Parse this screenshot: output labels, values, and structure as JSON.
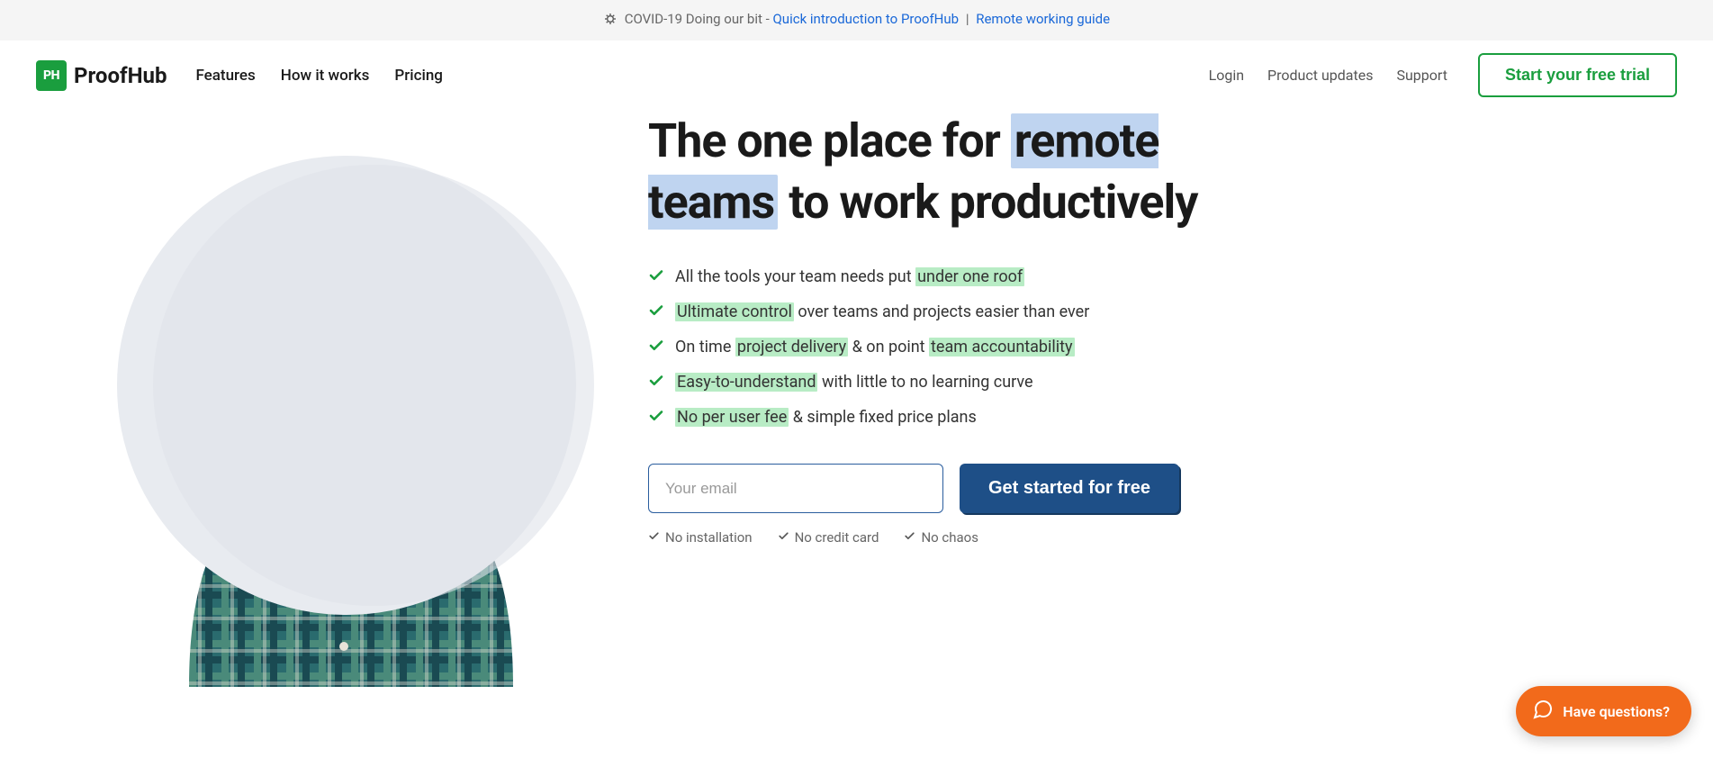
{
  "announcement": {
    "covid_text": "COVID-19 Doing our bit - ",
    "link1": "Quick introduction to ProofHub",
    "separator": "|",
    "link2": "Remote working guide"
  },
  "logo": {
    "mark": "PH",
    "text": "ProofHub"
  },
  "nav": {
    "items": [
      "Features",
      "How it works",
      "Pricing"
    ],
    "right": [
      "Login",
      "Product updates",
      "Support"
    ],
    "trial_button": "Start your free trial"
  },
  "hero": {
    "title_pre": "The one place for ",
    "title_highlight": "remote teams",
    "title_post": " to work productively",
    "bullets": [
      {
        "pre": "All the tools your team needs put ",
        "hl1": "under one roof",
        "mid": "",
        "hl2": "",
        "post": ""
      },
      {
        "pre": "",
        "hl1": "Ultimate control",
        "mid": " over teams and projects easier than ever",
        "hl2": "",
        "post": ""
      },
      {
        "pre": "On time ",
        "hl1": "project delivery",
        "mid": " & on point ",
        "hl2": "team accountability",
        "post": ""
      },
      {
        "pre": "",
        "hl1": "Easy-to-understand",
        "mid": " with little to no learning curve",
        "hl2": "",
        "post": ""
      },
      {
        "pre": "",
        "hl1": "No per user fee",
        "mid": " & simple fixed price plans",
        "hl2": "",
        "post": ""
      }
    ],
    "email_placeholder": "Your email",
    "get_started": "Get started for free",
    "sub_checks": [
      "No installation",
      "No credit card",
      "No chaos"
    ]
  },
  "help_widget": {
    "label": "Have questions?"
  }
}
